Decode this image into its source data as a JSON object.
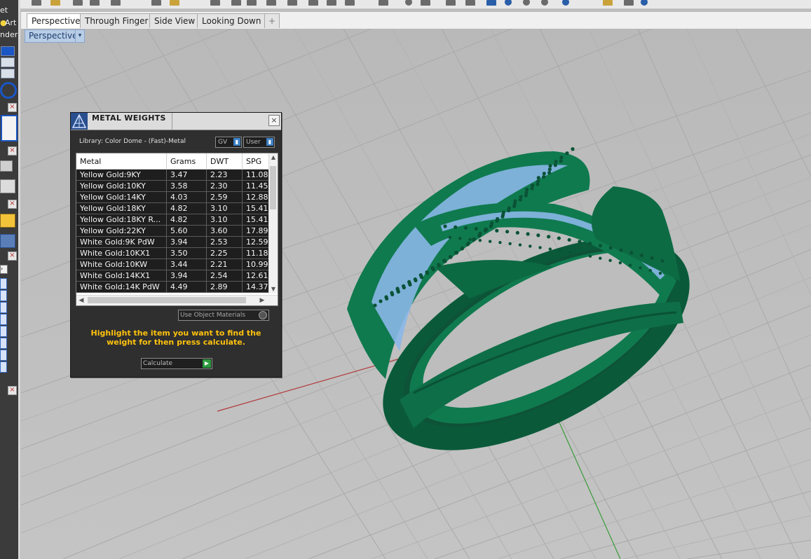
{
  "left_dock": {
    "labels": [
      "et",
      "Art",
      "nder"
    ]
  },
  "viewport": {
    "tabs": [
      {
        "label": "Perspective",
        "active": true
      },
      {
        "label": "Through Finger",
        "active": false
      },
      {
        "label": "Side View",
        "active": false
      },
      {
        "label": "Looking Down",
        "active": false
      }
    ],
    "add_tab_icon": "+",
    "title": "Perspective",
    "title_dropdown_icon": "▾",
    "background_color": "#bdbdbd",
    "ring_color": "#0c6b45",
    "gem_color": "#8ab7e8",
    "x_axis_color": "#b23a3a",
    "y_axis_color": "#3a9a3a"
  },
  "dialog": {
    "title": "METAL WEIGHTS",
    "close_icon": "×",
    "library_label": "Library: Color Dome - (Fast)-Metal",
    "unit_select": "GV",
    "scope_select": "User",
    "columns": [
      "Metal",
      "Grams",
      "DWT",
      "SPG"
    ],
    "rows": [
      {
        "metal": "Yellow Gold:9KY",
        "grams": "3.47",
        "dwt": "2.23",
        "spg": "11.08"
      },
      {
        "metal": "Yellow Gold:10KY",
        "grams": "3.58",
        "dwt": "2.30",
        "spg": "11.45"
      },
      {
        "metal": "Yellow Gold:14KY",
        "grams": "4.03",
        "dwt": "2.59",
        "spg": "12.88"
      },
      {
        "metal": "Yellow Gold:18KY",
        "grams": "4.82",
        "dwt": "3.10",
        "spg": "15.41"
      },
      {
        "metal": "Yellow Gold:18KY R...",
        "grams": "4.82",
        "dwt": "3.10",
        "spg": "15.41"
      },
      {
        "metal": "Yellow Gold:22KY",
        "grams": "5.60",
        "dwt": "3.60",
        "spg": "17.89"
      },
      {
        "metal": "White Gold:9K PdW",
        "grams": "3.94",
        "dwt": "2.53",
        "spg": "12.59"
      },
      {
        "metal": "White Gold:10KX1",
        "grams": "3.50",
        "dwt": "2.25",
        "spg": "11.18"
      },
      {
        "metal": "White Gold:10KW",
        "grams": "3.44",
        "dwt": "2.21",
        "spg": "10.99"
      },
      {
        "metal": "White Gold:14KX1",
        "grams": "3.94",
        "dwt": "2.54",
        "spg": "12.61"
      },
      {
        "metal": "White Gold:14K PdW",
        "grams": "4.49",
        "dwt": "2.89",
        "spg": "14.37"
      }
    ],
    "use_object_materials": "Use Object Materials",
    "hint": "Highlight the item you want to find the weight for then press calculate.",
    "calculate_label": "Calculate",
    "accent_color": "#ffc20e"
  }
}
